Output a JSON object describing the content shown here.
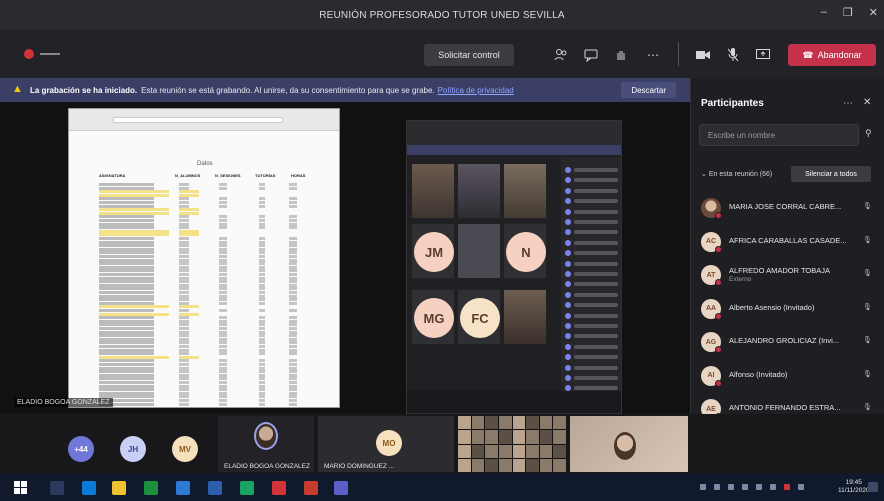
{
  "window": {
    "title": "REUNIÓN PROFESORADO TUTOR UNED SEVILLA",
    "controls": [
      "–",
      "❐",
      "✕"
    ]
  },
  "toolbar": {
    "control_label": "Solicitar control",
    "leave_label": "Abandonar",
    "icons": [
      "people-icon",
      "chat-icon",
      "raise-hand-icon",
      "more-icon",
      "camera-icon",
      "mic-icon",
      "share-icon"
    ]
  },
  "banner": {
    "bold_text": "La grabación se ha iniciado.",
    "text": "Esta reunión se está grabando. Al unirse, da su consentimiento para que se grabe.",
    "link": "Política de privacidad",
    "dismiss_label": "Descartar"
  },
  "stage": {
    "sharer_label": "ELADIO BOGOA GONZALEZ",
    "sheet_title": "Datos",
    "sheet_header": [
      "ASIGNATURA",
      "N_ALUMNOS",
      "N_SESIONES",
      "TUTORÍAS",
      "HORAS"
    ],
    "inner_avatars": [
      {
        "initials": "JM",
        "color": "#f6d1c1"
      },
      {
        "initials": "N",
        "color": "#f6d1c1"
      },
      {
        "initials": "MG",
        "color": "#f6d1c1"
      },
      {
        "initials": "FC",
        "color": "#f6e3c8"
      }
    ]
  },
  "participants": {
    "title": "Participantes",
    "search_placeholder": "Escribe un nombre",
    "section_label": "En esta reunión (66)",
    "mute_all_label": "Silenciar a todos",
    "list": [
      {
        "name": "MARIA JOSE CORRAL CABRE...",
        "initials": "MC",
        "photo": true,
        "sub": ""
      },
      {
        "name": "AFRICA CARABALLAS CASADE...",
        "initials": "AC",
        "photo": false,
        "sub": ""
      },
      {
        "name": "ALFREDO AMADOR TOBAJA",
        "initials": "AT",
        "photo": false,
        "sub": "Externo"
      },
      {
        "name": "Alberto Asensio (Invitado)",
        "initials": "AA",
        "photo": false,
        "sub": ""
      },
      {
        "name": "ALEJANDRO GROLICIAZ (Invi...",
        "initials": "AG",
        "photo": false,
        "sub": ""
      },
      {
        "name": "Alfonso (Invitado)",
        "initials": "AI",
        "photo": false,
        "sub": ""
      },
      {
        "name": "ANTONIO FERNANDO ESTRA...",
        "initials": "AE",
        "photo": false,
        "sub": ""
      },
      {
        "name": "ANTONIO JESUS ACEVEDO B...",
        "initials": "AB",
        "photo": false,
        "sub": ""
      },
      {
        "name": "Antonio Lara (Invitado)",
        "initials": "AL",
        "photo": false,
        "sub": ""
      }
    ]
  },
  "strip": {
    "overflow_label": "+44",
    "avatars": [
      {
        "initials": "JH",
        "color": "#c9cff5",
        "text_color": "#3b4291"
      },
      {
        "initials": "MV",
        "color": "#f6e0bd",
        "text_color": "#8a5a1f"
      },
      {
        "initials": "MO",
        "color": "#f6e0bd",
        "text_color": "#8a5a1f"
      }
    ],
    "speaker_label": "ELADIO BOGOA GONZALEZ",
    "second_label": "MARIO DOMINGUEZ ..."
  },
  "taskbar": {
    "time": "19:45",
    "date": "11/11/2020"
  }
}
